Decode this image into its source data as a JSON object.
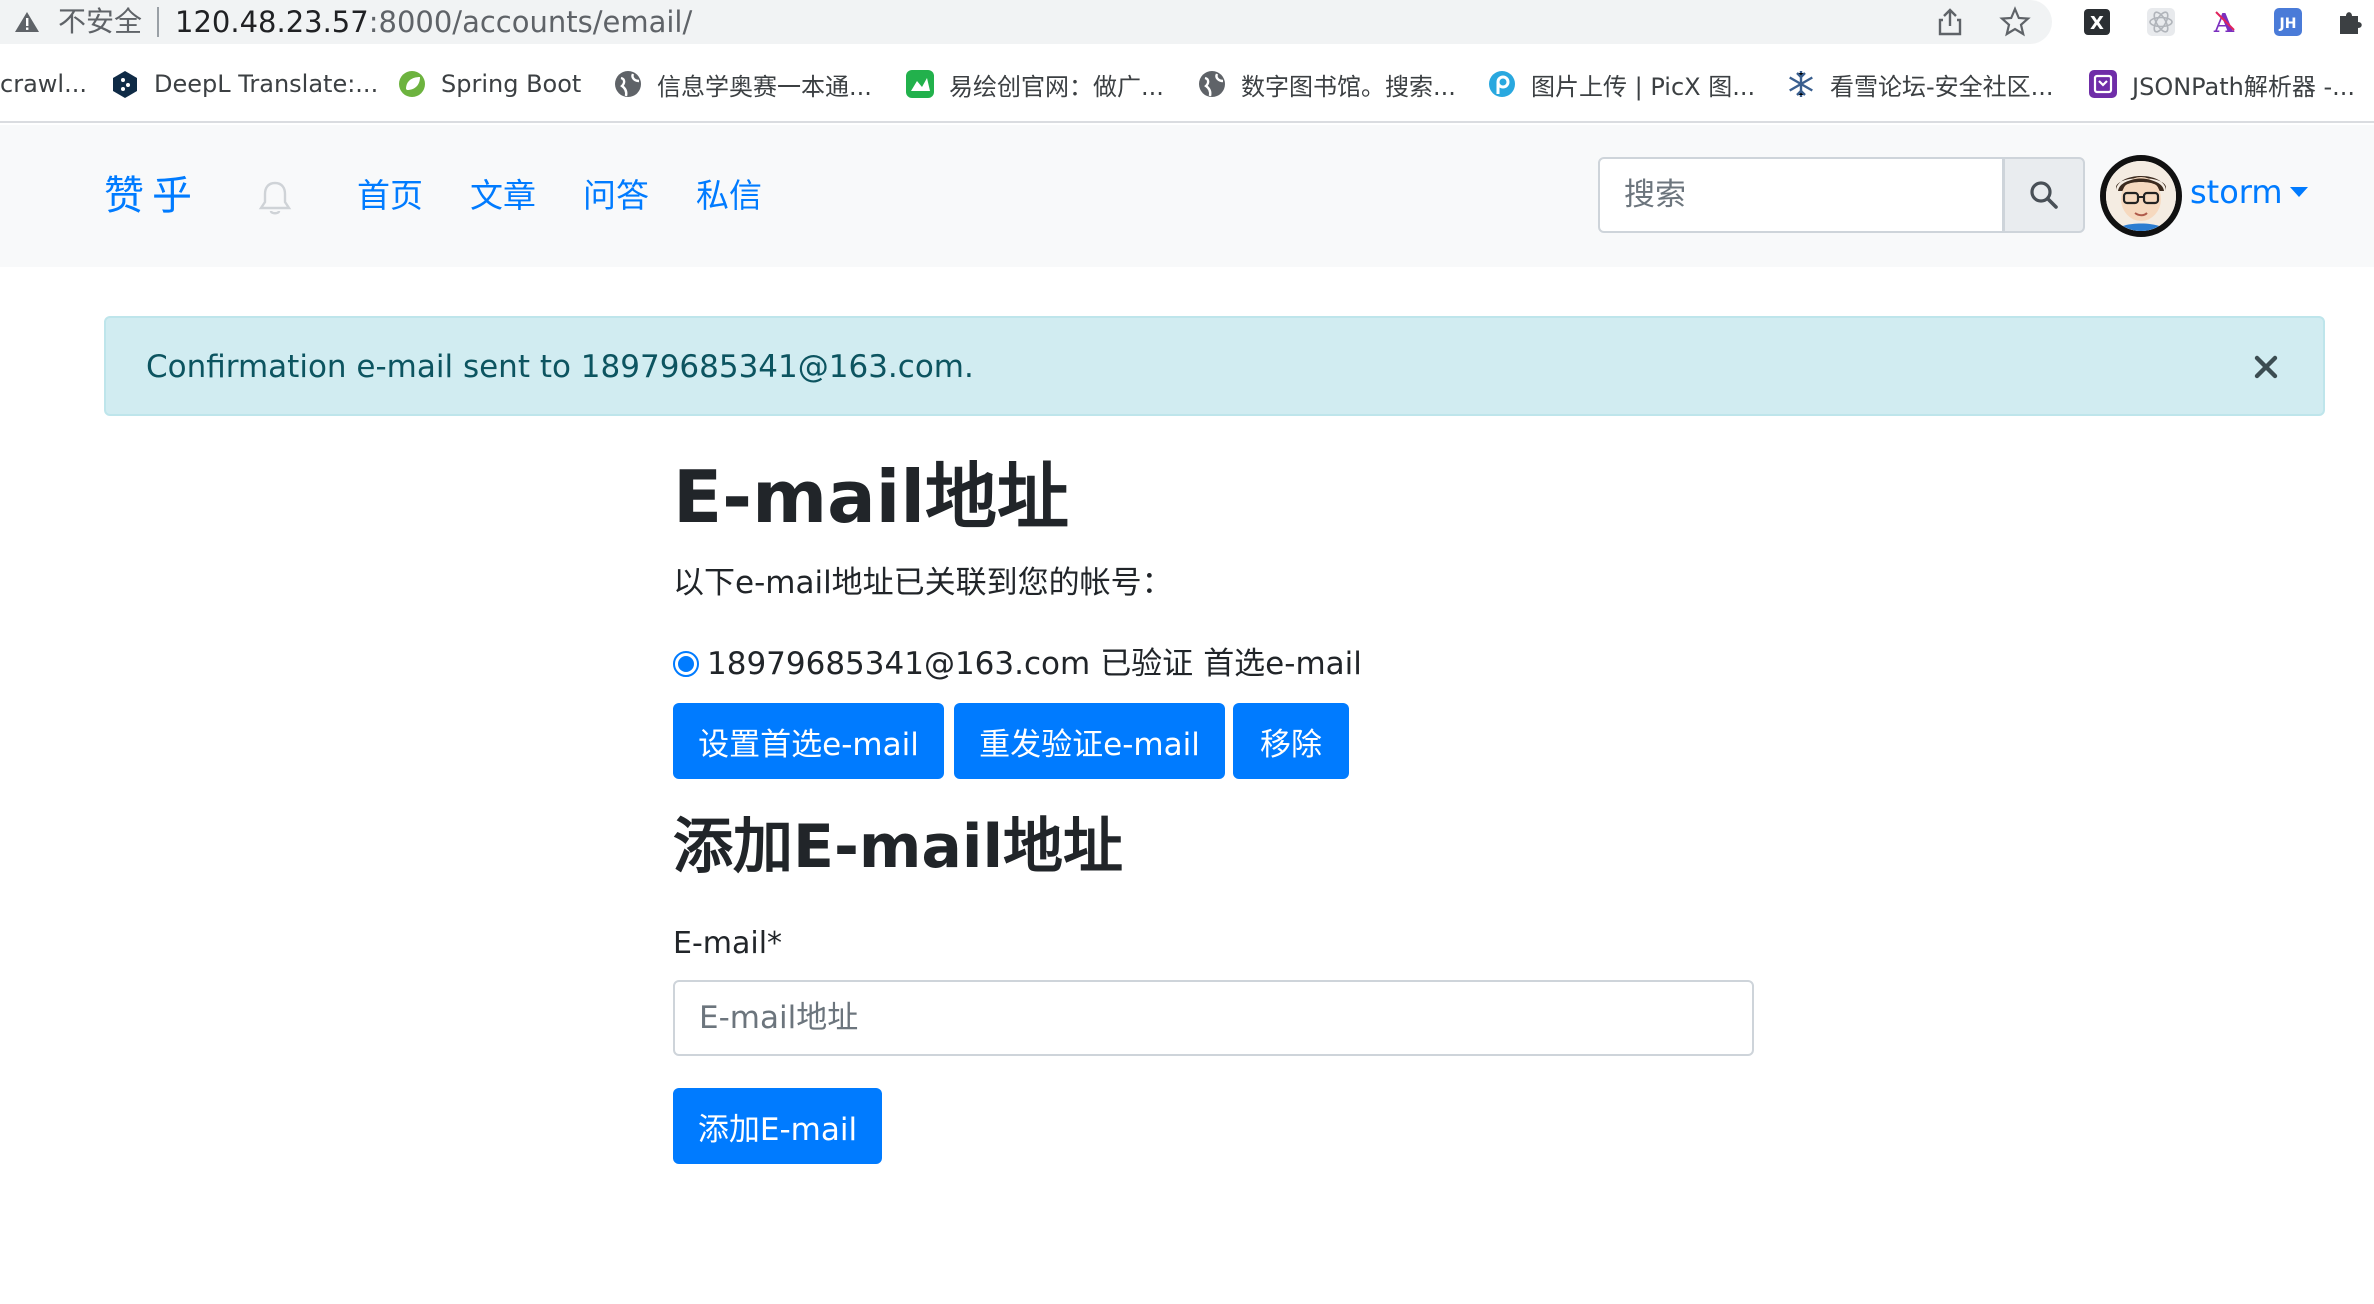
{
  "browser": {
    "insecure_label": "不安全",
    "url_host": "120.48.23.57",
    "url_path": ":8000/accounts/email/",
    "bookmarks": [
      {
        "label": "crawl...",
        "icon": "none"
      },
      {
        "label": "DeepL Translate:...",
        "icon": "deepl-icon"
      },
      {
        "label": "Spring Boot",
        "icon": "spring-icon"
      },
      {
        "label": "信息学奥赛一本通...",
        "icon": "globe-icon"
      },
      {
        "label": "易绘创官网：做广...",
        "icon": "yihuichuang-icon"
      },
      {
        "label": "数字图书馆。搜索...",
        "icon": "globe-icon"
      },
      {
        "label": "图片上传 | PicX 图...",
        "icon": "picx-icon"
      },
      {
        "label": "看雪论坛-安全社区...",
        "icon": "snowflake-icon"
      },
      {
        "label": "JSONPath解析器 -...",
        "icon": "jsonpath-icon"
      }
    ],
    "extensions": [
      "share-icon",
      "star-icon",
      "excel-icon",
      "react-icon",
      "font-icon",
      "jh-icon",
      "puzzle-icon"
    ]
  },
  "navbar": {
    "brand": "赞乎",
    "links": [
      "首页",
      "文章",
      "问答",
      "私信"
    ],
    "search_placeholder": "搜索",
    "username": "storm"
  },
  "alert": {
    "message": "Confirmation e-mail sent to 18979685341@163.com."
  },
  "main": {
    "title": "E-mail地址",
    "lead": "以下e-mail地址已关联到您的帐号：",
    "email": {
      "address": "18979685341@163.com",
      "status": "已验证",
      "primary": "首选e-mail"
    },
    "buttons": {
      "set_primary": "设置首选e-mail",
      "resend": "重发验证e-mail",
      "remove": "移除"
    },
    "add_title": "添加E-mail地址",
    "field_label": "E-mail*",
    "field_placeholder": "E-mail地址",
    "add_button": "添加E-mail"
  },
  "colors": {
    "primary": "#007bff",
    "alert_bg": "#d1ecf1",
    "alert_text": "#0c5460",
    "navbar_bg": "#f8f9fa"
  }
}
